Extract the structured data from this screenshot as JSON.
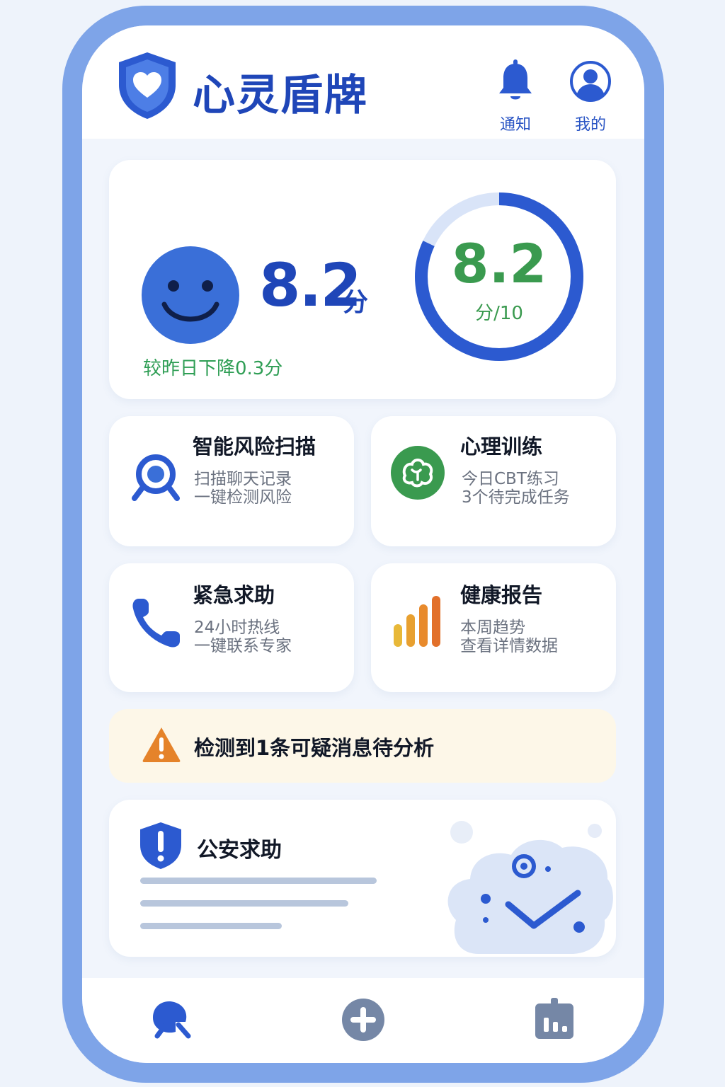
{
  "app": {
    "title": "心灵盾牌"
  },
  "header": {
    "notify_label": "通知",
    "profile_label": "我的"
  },
  "score": {
    "value": "8.2",
    "unit": "分",
    "change_text": "较昨日下降0.3分",
    "ring_value": "8.2",
    "ring_sub": "分/10",
    "ring_fraction": 0.82
  },
  "features": [
    {
      "title": "智能风险扫描",
      "line1": "扫描聊天记录",
      "line2": "一键检测风险",
      "icon": "search-scan-icon"
    },
    {
      "title": "心理训练",
      "line1": "今日CBT练习",
      "line2": "3个待完成任务",
      "icon": "brain-icon"
    },
    {
      "title": "紧急求助",
      "line1": "24小时热线",
      "line2": "一键联系专家",
      "icon": "phone-icon"
    },
    {
      "title": "健康报告",
      "line1": "本周趋势",
      "line2": "查看详情数据",
      "icon": "bar-chart-icon"
    }
  ],
  "alert": {
    "text": "检测到1条可疑消息待分析",
    "icon": "warning-icon"
  },
  "police": {
    "title": "公安求助",
    "icon": "shield-alert-icon"
  },
  "colors": {
    "primary": "#1f46b8",
    "accent_blue": "#3a6fd8",
    "green": "#3a9a4f",
    "alert_bg": "#fdf7e8",
    "warning": "#e5832a"
  },
  "nav": {
    "items": [
      "home-icon",
      "add-icon",
      "stats-icon"
    ]
  }
}
